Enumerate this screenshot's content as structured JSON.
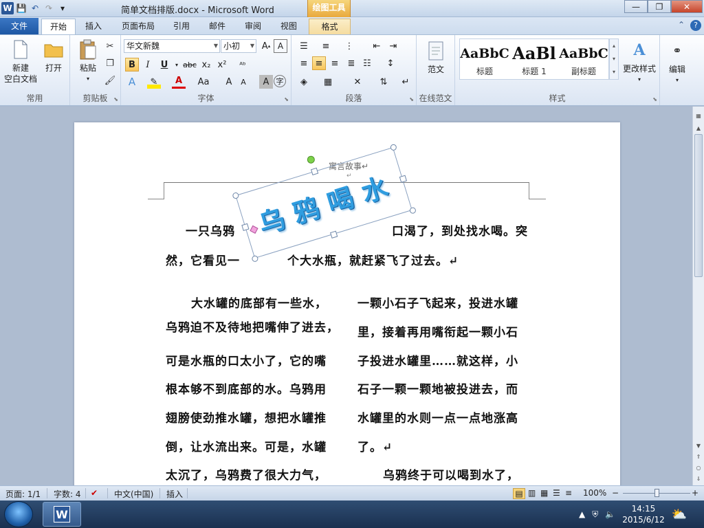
{
  "window": {
    "doc_title": "简单文档排版.docx - Microsoft Word",
    "context_tab_group": "绘图工具",
    "minimize": "—",
    "restore": "❐",
    "close": "✕"
  },
  "qat": {
    "word_logo": "W",
    "save": "💾",
    "undo": "↶",
    "redo": "↷",
    "customize": "▾"
  },
  "tabs": {
    "file": "文件",
    "items": [
      "开始",
      "插入",
      "页面布局",
      "引用",
      "邮件",
      "审阅",
      "视图"
    ],
    "format": "格式",
    "help_min": "⌃",
    "help": "?"
  },
  "ribbon": {
    "common": {
      "label": "常用",
      "new_doc": "新建\n空白文档",
      "new_doc_line1": "新建",
      "new_doc_line2": "空白文档",
      "open": "打开"
    },
    "clipboard": {
      "label": "剪贴板",
      "paste": "粘贴"
    },
    "font": {
      "label": "字体",
      "font_name": "华文新魏",
      "font_size": "小初",
      "bold": "B",
      "italic": "I",
      "underline": "U",
      "strike": "abc",
      "subscript": "x₂",
      "superscript": "x²",
      "grow": "A",
      "shrink": "A",
      "case": "Aa",
      "clear": "A"
    },
    "paragraph": {
      "label": "段落"
    },
    "online": {
      "label": "在线范文",
      "button": "范文"
    },
    "styles": {
      "label": "样式",
      "items": [
        {
          "sample": "AaBbC",
          "name": "标题"
        },
        {
          "sample": "AaBl",
          "name": "标题 1"
        },
        {
          "sample": "AaBbC",
          "name": "副标题"
        }
      ],
      "change_styles": "更改样式"
    },
    "editing": {
      "label": "编辑"
    }
  },
  "document": {
    "header_text": "寓言故事↵",
    "header_mark": "↵",
    "wordart": "乌鸦喝水",
    "lines": [
      {
        "text": "一只乌鸦",
        "id": "l1a"
      },
      {
        "text": "口渴了，到处找水喝。突",
        "id": "l1b"
      },
      {
        "text": "然，它看见一",
        "id": "l2a"
      },
      {
        "text": "个大水瓶，就赶紧飞了过去。↵",
        "id": "l2b"
      }
    ],
    "col1": [
      "大水罐的底部有一些水，",
      "乌鸦迫不及待地把嘴伸了进去，",
      "可是水瓶的口太小了，它的嘴",
      "根本够不到底部的水。乌鸦用",
      "翅膀使劲推水罐，想把水罐推",
      "倒，让水流出来。可是，水罐",
      "太沉了，乌鸦费了很大力气，"
    ],
    "col2": [
      "一颗小石子飞起来，投进水罐",
      "里，接着再用嘴衔起一颗小石",
      "子投进水罐里……就这样，小",
      "石子一颗一颗地被投进去，而",
      "水罐里的水则一点一点地涨高",
      "了。↵",
      "乌鸦终于可以喝到水了，"
    ]
  },
  "status": {
    "page": "页面: 1/1",
    "words": "字数: 4",
    "language": "中文(中国)",
    "insert": "插入",
    "zoom": "100%",
    "zoom_minus": "−",
    "zoom_plus": "+"
  },
  "taskbar": {
    "time": "14:15",
    "date": "2015/6/12",
    "word_icon": "W"
  }
}
